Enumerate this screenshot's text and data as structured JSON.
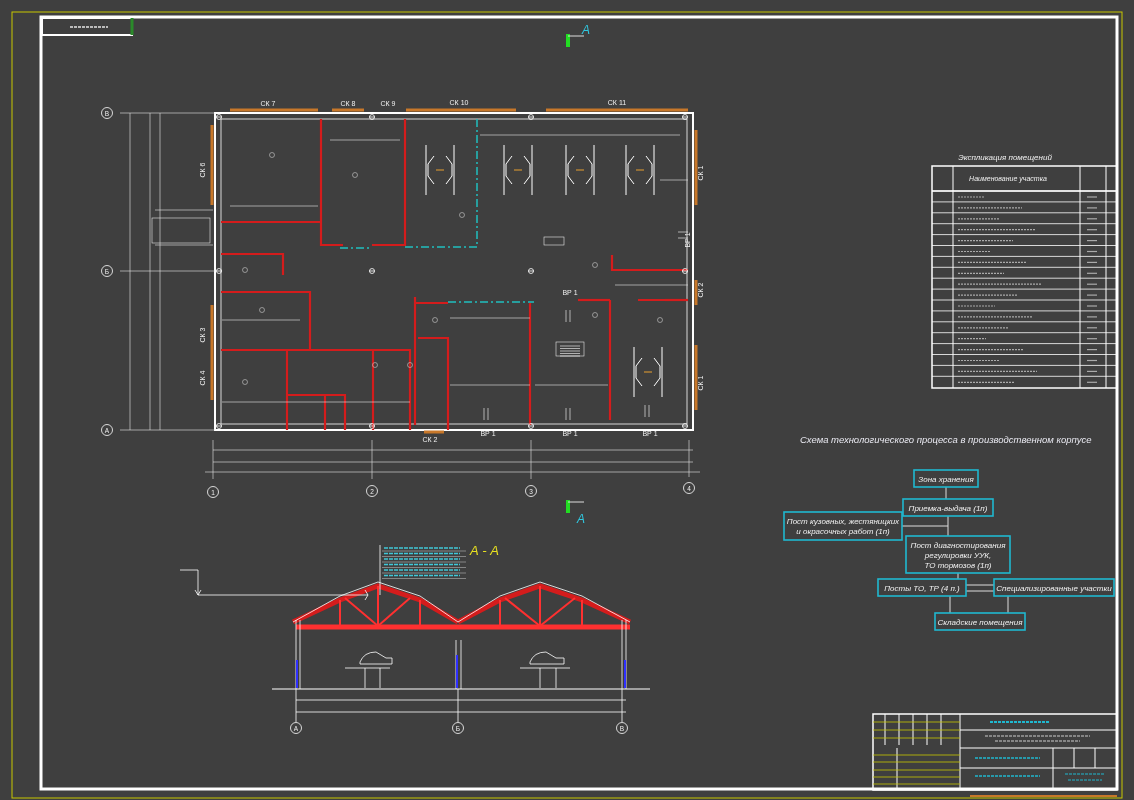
{
  "section_cut_marks": [
    {
      "label": "А"
    },
    {
      "label": "А"
    }
  ],
  "floor_plan": {
    "wall_labels": [
      {
        "text": "СК 7",
        "vertical": false
      },
      {
        "text": "СК 8",
        "vertical": false
      },
      {
        "text": "СК 9",
        "vertical": false
      },
      {
        "text": "СК 10",
        "vertical": false
      },
      {
        "text": "СК 11",
        "vertical": false
      },
      {
        "text": "СК 6",
        "vertical": true
      },
      {
        "text": "СК 3",
        "vertical": true
      },
      {
        "text": "СК 4",
        "vertical": true
      },
      {
        "text": "СК 1",
        "vertical": true
      },
      {
        "text": "ВР 1",
        "vertical": true
      },
      {
        "text": "СК 2",
        "vertical": true
      },
      {
        "text": "СК 1",
        "vertical": true
      },
      {
        "text": "ВР 1",
        "vertical": false
      },
      {
        "text": "СК 2",
        "vertical": false
      },
      {
        "text": "ВР 1",
        "vertical": false
      },
      {
        "text": "ВР 1",
        "vertical": false
      },
      {
        "text": "ВР 1",
        "vertical": false
      }
    ],
    "axis_markers": [
      {
        "label": "В"
      },
      {
        "label": "Б"
      },
      {
        "label": "А"
      },
      {
        "label": "1"
      },
      {
        "label": "2"
      },
      {
        "label": "3"
      },
      {
        "label": "4"
      }
    ]
  },
  "section": {
    "title": "А - А",
    "axis_markers": [
      {
        "label": "А"
      },
      {
        "label": "Б"
      },
      {
        "label": "В"
      }
    ]
  },
  "room_table": {
    "title": "Экспликация помещений",
    "column_header": "Наименование участка"
  },
  "process_scheme": {
    "title": "Схема технологического процесса в производственном корпусе",
    "nodes": [
      {
        "lines": [
          "Зона хранения"
        ]
      },
      {
        "lines": [
          "Приемка-выдача (1п)"
        ]
      },
      {
        "lines": [
          "Пост кузовных, жестяницких",
          "и окрасочных работ (1п)"
        ]
      },
      {
        "lines": [
          "Пост диагностирования",
          "регулировки УУК,",
          "ТО тормозов (1п)"
        ]
      },
      {
        "lines": [
          "Посты ТО, ТР (4 п.)"
        ]
      },
      {
        "lines": [
          "Специализированные участки"
        ]
      },
      {
        "lines": [
          "Складские помещения"
        ]
      }
    ]
  }
}
